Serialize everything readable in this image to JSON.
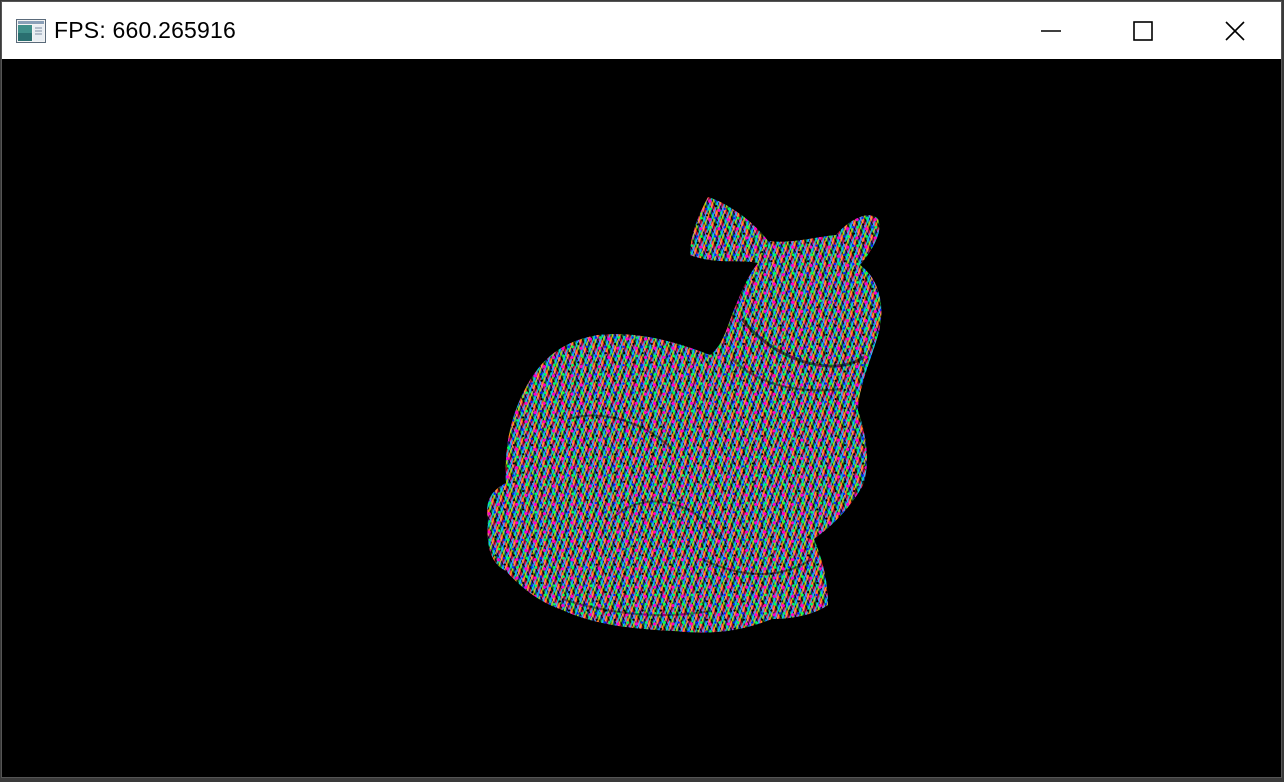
{
  "window": {
    "title": "FPS: 660.265916",
    "icon": "application-icon",
    "controls": [
      {
        "name": "minimize-button",
        "icon": "minimize-icon"
      },
      {
        "name": "maximize-button",
        "icon": "maximize-icon"
      },
      {
        "name": "close-button",
        "icon": "close-icon"
      }
    ]
  },
  "scene": {
    "background": "#000000",
    "model": "stanford-bunny",
    "shading": "rainbow-noise-normals"
  }
}
